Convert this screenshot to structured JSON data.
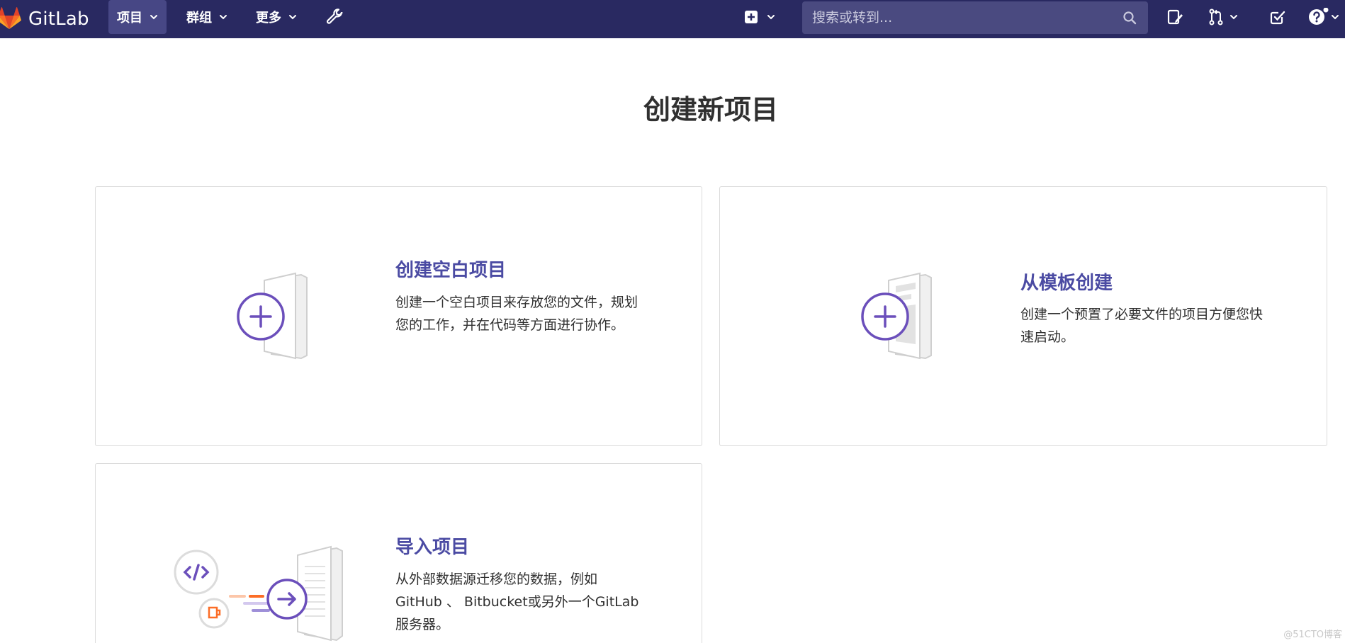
{
  "brand": {
    "name": "GitLab"
  },
  "nav": {
    "projects": "项目",
    "groups": "群组",
    "more": "更多"
  },
  "search": {
    "placeholder": "搜索或转到..."
  },
  "page": {
    "title": "创建新项目"
  },
  "cards": [
    {
      "title": "创建空白项目",
      "desc": "创建一个空白项目来存放您的文件，规划您的工作，并在代码等方面进行协作。"
    },
    {
      "title": "从模板创建",
      "desc": "创建一个预置了必要文件的项目方便您快速启动。"
    },
    {
      "title": "导入项目",
      "desc": "从外部数据源迁移您的数据，例如 GitHub 、 Bitbucket或另外一个GitLab服务器。"
    }
  ],
  "watermark": "@51CTO博客",
  "colors": {
    "navbar": "#292961",
    "accent": "#4b4ba3",
    "illustration": "#6b4fbb"
  }
}
